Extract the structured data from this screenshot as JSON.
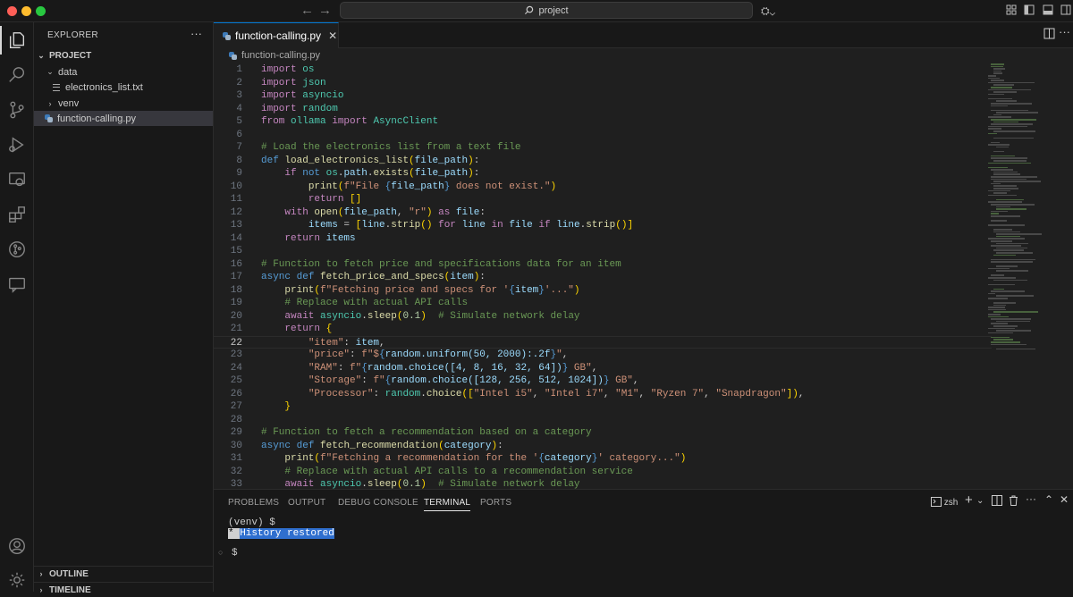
{
  "titlebar": {
    "search": "project",
    "colors": {
      "red": "#ff5f57",
      "yellow": "#febc2e",
      "green": "#28c840"
    }
  },
  "sidebar": {
    "title": "EXPLORER",
    "more": "···",
    "items": [
      {
        "label": "PROJECT",
        "type": "folder-open"
      },
      {
        "label": "data",
        "type": "folder-open"
      },
      {
        "label": "electronics_list.txt",
        "type": "txt"
      },
      {
        "label": "venv",
        "type": "folder-closed"
      },
      {
        "label": "function-calling.py",
        "type": "py"
      }
    ],
    "outline": "OUTLINE",
    "timeline": "TIMELINE"
  },
  "editor": {
    "tab": "function-calling.py",
    "breadcrumb": "function-calling.py",
    "current_line": 22,
    "lines": [
      "import os",
      "import json",
      "import asyncio",
      "import random",
      "from ollama import AsyncClient",
      "",
      "# Load the electronics list from a text file",
      "def load_electronics_list(file_path):",
      "    if not os.path.exists(file_path):",
      "        print(f\"File {file_path} does not exist.\")",
      "        return []",
      "    with open(file_path, \"r\") as file:",
      "        items = [line.strip() for line in file if line.strip()]",
      "    return items",
      "",
      "# Function to fetch price and specifications data for an item",
      "async def fetch_price_and_specs(item):",
      "    print(f\"Fetching price and specs for '{item}'...\")",
      "    # Replace with actual API calls",
      "    await asyncio.sleep(0.1)  # Simulate network delay",
      "    return {",
      "        \"item\": item,",
      "        \"price\": f\"${random.uniform(50, 2000):.2f}\",",
      "        \"RAM\": f\"{random.choice([4, 8, 16, 32, 64])} GB\",",
      "        \"Storage\": f\"{random.choice([128, 256, 512, 1024])} GB\",",
      "        \"Processor\": random.choice([\"Intel i5\", \"Intel i7\", \"M1\", \"Ryzen 7\", \"Snapdragon\"]),",
      "    }",
      "",
      "# Function to fetch a recommendation based on a category",
      "async def fetch_recommendation(category):",
      "    print(f\"Fetching a recommendation for the '{category}' category...\")",
      "    # Replace with actual API calls to a recommendation service",
      "    await asyncio.sleep(0.1)  # Simulate network delay"
    ]
  },
  "panel": {
    "tabs": [
      "PROBLEMS",
      "OUTPUT",
      "DEBUG CONSOLE",
      "TERMINAL",
      "PORTS"
    ],
    "active_tab": "TERMINAL",
    "shell": "zsh",
    "terminal": {
      "line1": "(venv) $",
      "star": " * ",
      "history": " History restored ",
      "prompt": "$"
    }
  }
}
